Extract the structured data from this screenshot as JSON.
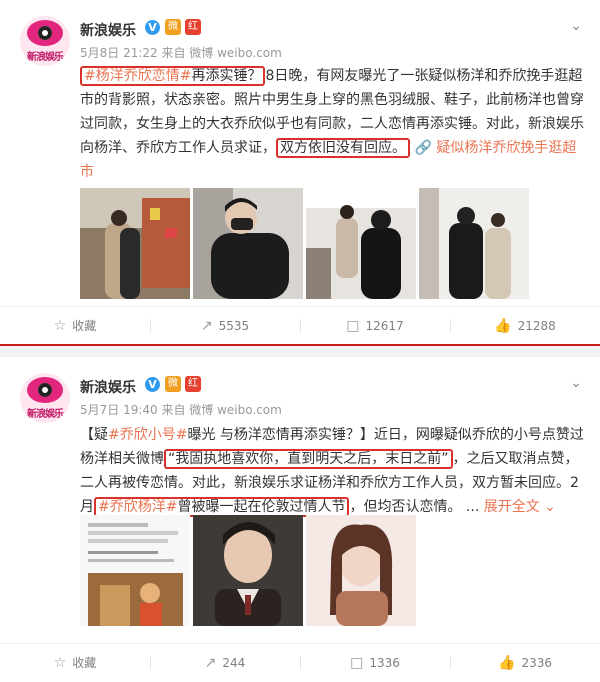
{
  "posts": [
    {
      "username": "新浪娱乐",
      "verified_badge": "V",
      "badge1": "微",
      "badge2": "红",
      "meta": "5月8日 21:22 来自 微博 weibo.com",
      "body": {
        "topic1": "#杨洋乔欣恋情#",
        "t1": "再添实锤？",
        "t2": "8日晚，有网友曝光了一张疑似杨洋和乔欣挽手逛超市的背影照，状态亲密。照片中男生身上穿的黑色羽绒服、鞋子，此前杨洋也曾穿过同款，女生身上的大衣乔欣似乎也有同款，二人恋情再添实锤。对此，新浪娱乐向杨洋、乔欣方工作人员求证，",
        "t3": "双方依旧没有回应。",
        "link": "疑似杨洋乔欣挽手逛超市"
      },
      "actions": {
        "favorite": "收藏",
        "repost": "5535",
        "comment": "12617",
        "like": "21288"
      }
    },
    {
      "username": "新浪娱乐",
      "verified_badge": "V",
      "badge1": "微",
      "badge2": "红",
      "meta": "5月7日 19:40 来自 微博 weibo.com",
      "body": {
        "b1": "【疑",
        "topic1": "#乔欣小号#",
        "b2": "曝光 与杨洋恋情再添实锤？】近日，网曝疑似乔欣的小号点赞过杨洋相关微博",
        "q": "“我固执地喜欢你，直到明天之后，末日之前”",
        "b3": "，之后又取消点赞，二人再被传恋情。对此，新浪娱乐求证杨洋和乔欣方工作人员，双方暂未回应。2月",
        "topic2": "#乔欣杨洋#",
        "b4": "曾被曝一起在伦敦过情人节",
        "b5": "，但均否认恋情。 ...",
        "expand": "展开全文"
      },
      "actions": {
        "favorite": "收藏",
        "repost": "244",
        "comment": "1336",
        "like": "2336"
      }
    }
  ],
  "icons": {
    "favorite": "star-icon",
    "repost": "repost-icon",
    "comment": "comment-icon",
    "like": "thumbs-up-icon",
    "menu": "chevron-down-icon"
  },
  "colors": {
    "topic": "#eb7350",
    "highlight_box": "#d9322c",
    "divider_accent": "#c81e1e"
  }
}
